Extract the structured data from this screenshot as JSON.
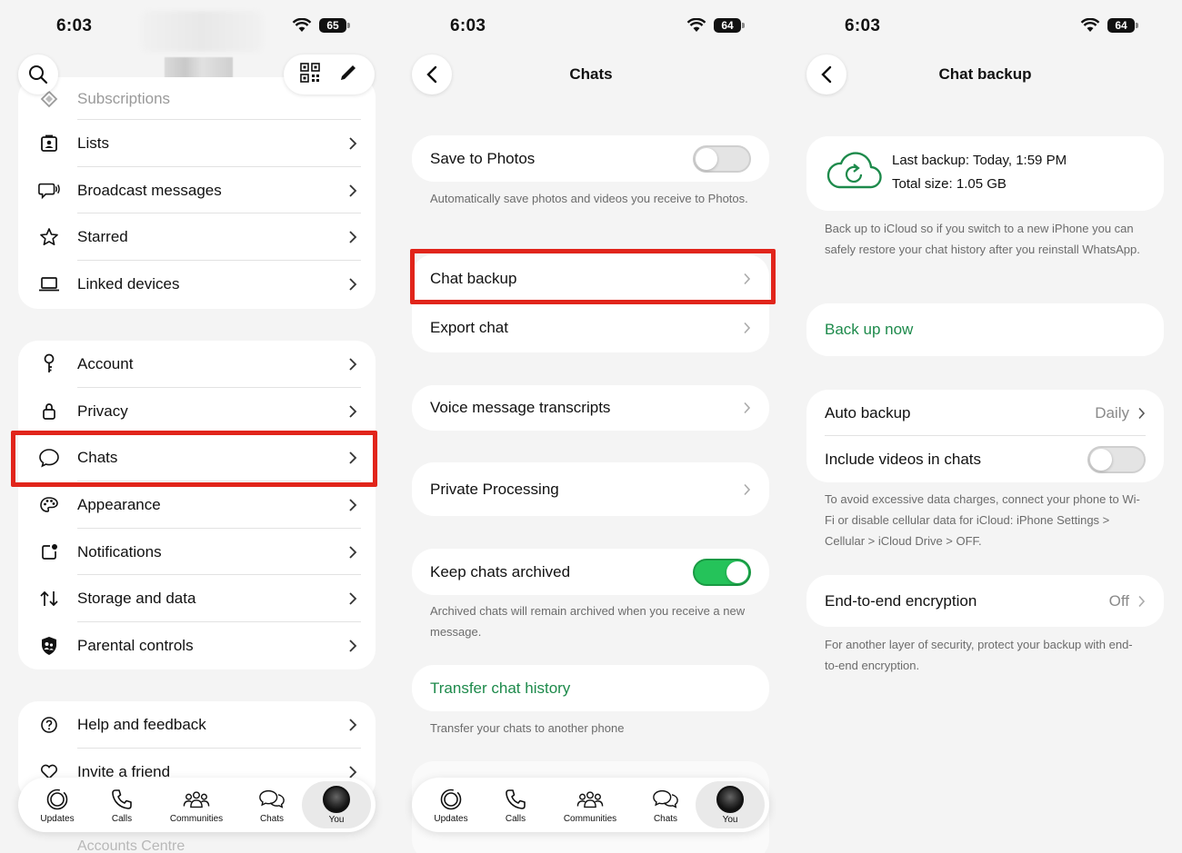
{
  "status": {
    "time": "6:03"
  },
  "panel1": {
    "battery": "65",
    "top_item": "Subscriptions",
    "group1": [
      "Lists",
      "Broadcast messages",
      "Starred",
      "Linked devices"
    ],
    "group2": [
      "Account",
      "Privacy",
      "Chats",
      "Appearance",
      "Notifications",
      "Storage and data",
      "Parental controls"
    ],
    "group3": [
      "Help and feedback",
      "Invite a friend"
    ],
    "bottom_faded": "Accounts Centre"
  },
  "panel2": {
    "battery": "64",
    "title": "Chats",
    "save_to_photos": "Save to Photos",
    "save_note": "Automatically save photos and videos you receive to Photos.",
    "chat_backup": "Chat backup",
    "export_chat": "Export chat",
    "voice_transcripts": "Voice message transcripts",
    "private_processing": "Private Processing",
    "keep_archived": "Keep chats archived",
    "archived_note": "Archived chats will remain archived when you receive a new message.",
    "transfer": "Transfer chat history",
    "transfer_note": "Transfer your chats to another phone",
    "save_to_photos_on": false,
    "keep_archived_on": true
  },
  "panel3": {
    "battery": "64",
    "title": "Chat backup",
    "last_backup": "Last backup: Today, 1:59 PM",
    "total_size": "Total size: 1.05 GB",
    "backup_note": "Back up to iCloud so if you switch to a new iPhone you can safely restore your chat history after you reinstall WhatsApp.",
    "back_up_now": "Back up now",
    "auto_backup": "Auto backup",
    "auto_backup_value": "Daily",
    "include_videos": "Include videos in chats",
    "include_videos_on": false,
    "videos_note": "To avoid excessive data charges, connect your phone to Wi-Fi or disable cellular data for iCloud: iPhone Settings > Cellular > iCloud Drive > OFF.",
    "e2e": "End-to-end encryption",
    "e2e_value": "Off",
    "e2e_note": "For another layer of security, protect your backup with end-to-end encryption."
  },
  "tabs": [
    "Updates",
    "Calls",
    "Communities",
    "Chats",
    "You"
  ],
  "colors": {
    "accent_green": "#1d8a4b",
    "toggle_on": "#25c35a",
    "highlight_red": "#e1251b"
  }
}
